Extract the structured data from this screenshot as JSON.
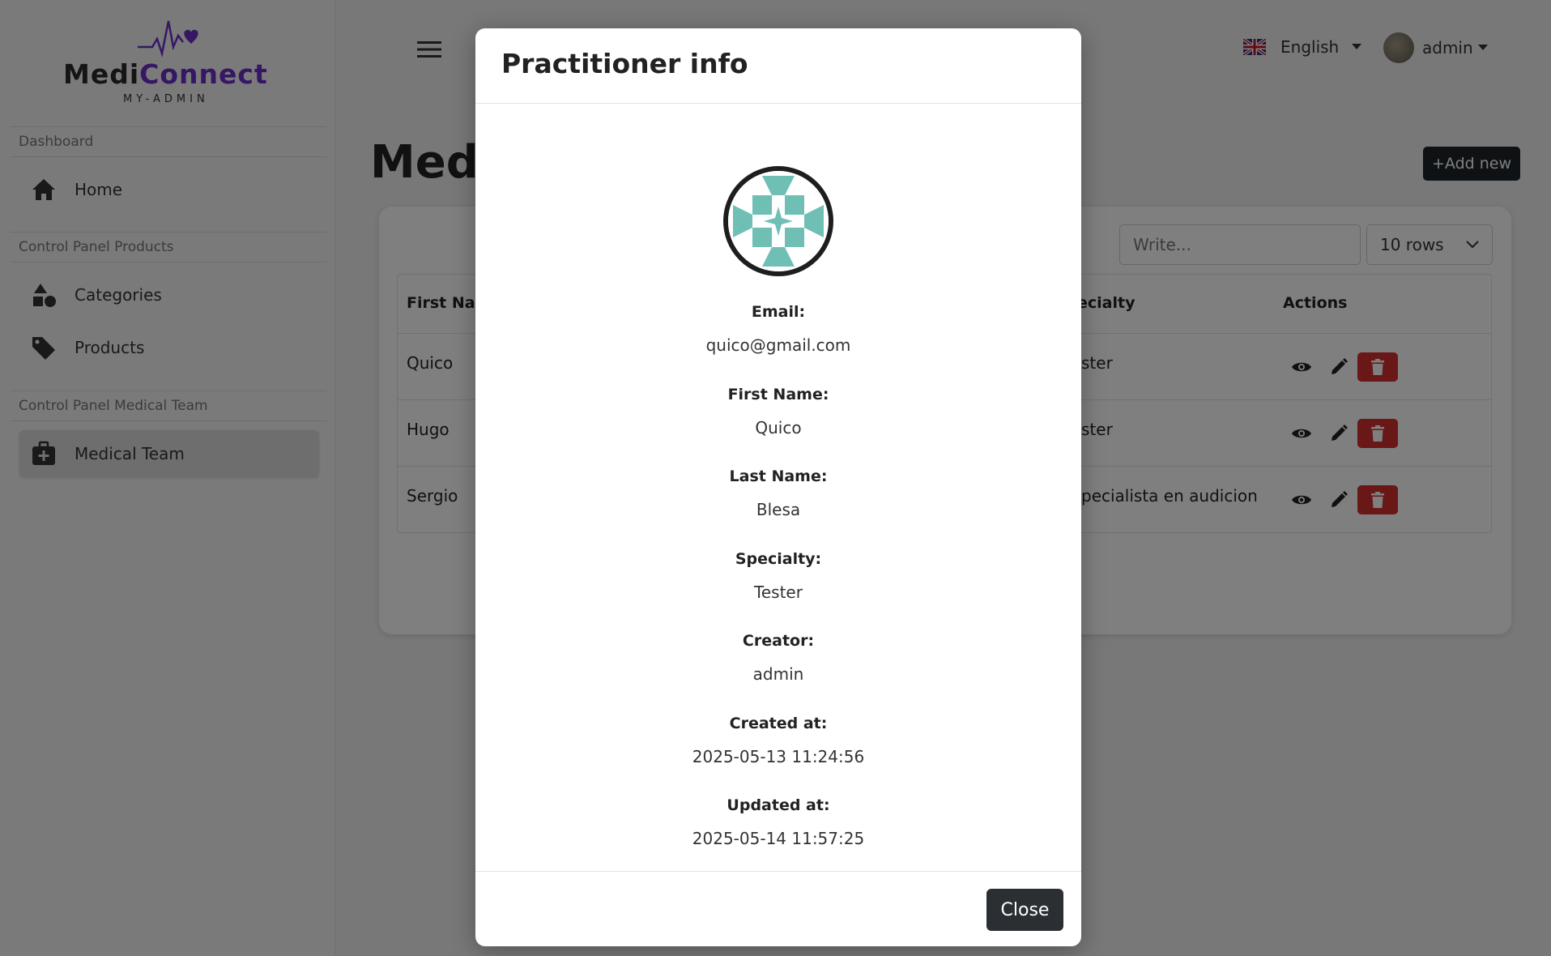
{
  "brand": {
    "name_part1": "Medi",
    "name_part2": "Connect",
    "subtitle": "MY-ADMIN"
  },
  "sidebar": {
    "sections": [
      {
        "label": "Dashboard"
      },
      {
        "label": "Control Panel Products"
      },
      {
        "label": "Control Panel Medical Team"
      }
    ],
    "items": [
      {
        "label": "Home",
        "icon": "home-icon"
      },
      {
        "label": "Categories",
        "icon": "shapes-icon"
      },
      {
        "label": "Products",
        "icon": "tag-icon"
      },
      {
        "label": "Medical Team",
        "icon": "medical-kit-icon",
        "active": true
      }
    ]
  },
  "header": {
    "language": "English",
    "user": "admin"
  },
  "main": {
    "title": "Medi",
    "add_label": "+Add new",
    "search_placeholder": "Write...",
    "rows_option": "10 rows",
    "columns": {
      "first": "First Nan",
      "specialty": "ecialty",
      "actions": "Actions"
    },
    "rows": [
      {
        "first_name": "Quico",
        "specialty": "ster"
      },
      {
        "first_name": "Hugo",
        "specialty": "ster"
      },
      {
        "first_name": "Sergio",
        "specialty": "pecialista en audicion"
      }
    ]
  },
  "modal": {
    "title": "Practitioner info",
    "fields": [
      {
        "label": "Email:",
        "value": "quico@gmail.com"
      },
      {
        "label": "First Name:",
        "value": "Quico"
      },
      {
        "label": "Last Name:",
        "value": "Blesa"
      },
      {
        "label": "Specialty:",
        "value": "Tester"
      },
      {
        "label": "Creator:",
        "value": "admin"
      },
      {
        "label": "Created at:",
        "value": "2025-05-13 11:24:56"
      },
      {
        "label": "Updated at:",
        "value": "2025-05-14 11:57:25"
      }
    ],
    "close_label": "Close"
  },
  "colors": {
    "brand_purple": "#6b2fc9",
    "danger": "#d32f2f",
    "dark_button": "#2b2f33",
    "avatar_teal": "#6fbfb5"
  }
}
